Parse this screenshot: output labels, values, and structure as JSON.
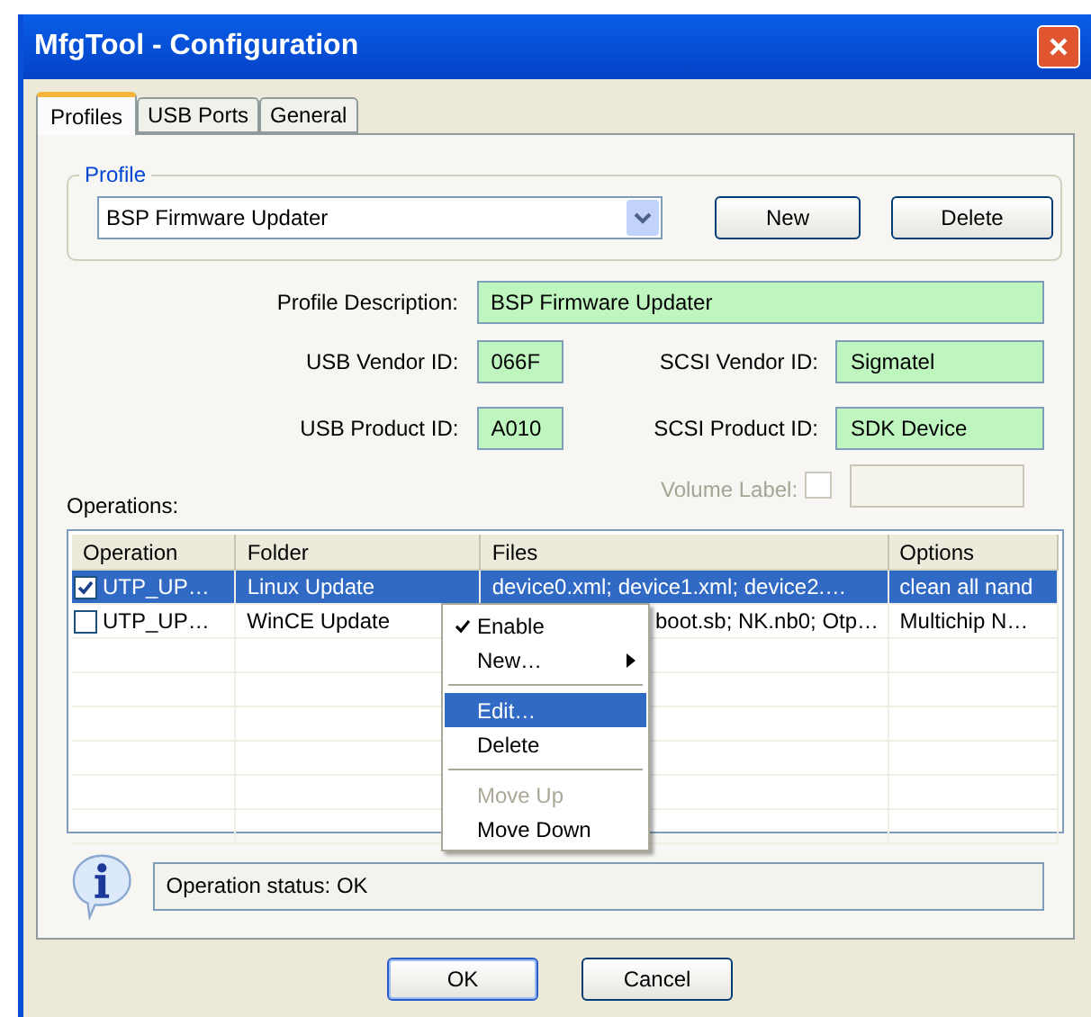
{
  "window": {
    "title": "MfgTool - Configuration"
  },
  "tabs": [
    {
      "label": "Profiles",
      "selected": true
    },
    {
      "label": "USB Ports",
      "selected": false
    },
    {
      "label": "General",
      "selected": false
    }
  ],
  "profile": {
    "group_label": "Profile",
    "value": "BSP Firmware Updater",
    "buttons": [
      "New",
      "Delete"
    ]
  },
  "fields": [
    {
      "label": "Profile Description:",
      "value": "BSP Firmware Updater"
    },
    {
      "label": "USB Vendor ID:",
      "value": "066F"
    },
    {
      "label": "SCSI Vendor ID:",
      "value": "Sigmatel"
    },
    {
      "label": "USB Product ID:",
      "value": "A010"
    },
    {
      "label": "SCSI Product ID:",
      "value": "SDK Device"
    }
  ],
  "volume_label": {
    "label": "Volume Label:",
    "checked": false,
    "disabled": true
  },
  "operations": {
    "label": "Operations:",
    "columns": [
      "Operation",
      "Folder",
      "Files",
      "Options"
    ],
    "rows": [
      {
        "checked": true,
        "selected": true,
        "cells": [
          "UTP_UP…",
          "Linux Update",
          "device0.xml; device1.xml; device2.…",
          "clean all nand"
        ]
      },
      {
        "checked": false,
        "selected": false,
        "cells": [
          "UTP_UP…",
          "WinCE Update",
          "boot.sb; NK.nb0; Otp…",
          "Multichip N…"
        ]
      }
    ]
  },
  "context_menu": [
    {
      "kind": "checked_item",
      "label": "Enable",
      "selected": false,
      "disabled": false
    },
    {
      "kind": "submenu_item",
      "label": "New…",
      "selected": false,
      "disabled": false
    },
    {
      "kind": "separator"
    },
    {
      "kind": "item",
      "label": "Edit…",
      "selected": true,
      "disabled": false
    },
    {
      "kind": "item",
      "label": "Delete",
      "selected": false,
      "disabled": false
    },
    {
      "kind": "separator"
    },
    {
      "kind": "item",
      "label": "Move Up",
      "selected": false,
      "disabled": true
    },
    {
      "kind": "item",
      "label": "Move Down",
      "selected": false,
      "disabled": false
    }
  ],
  "status": "Operation status: OK",
  "buttons": [
    "OK",
    "Cancel"
  ]
}
